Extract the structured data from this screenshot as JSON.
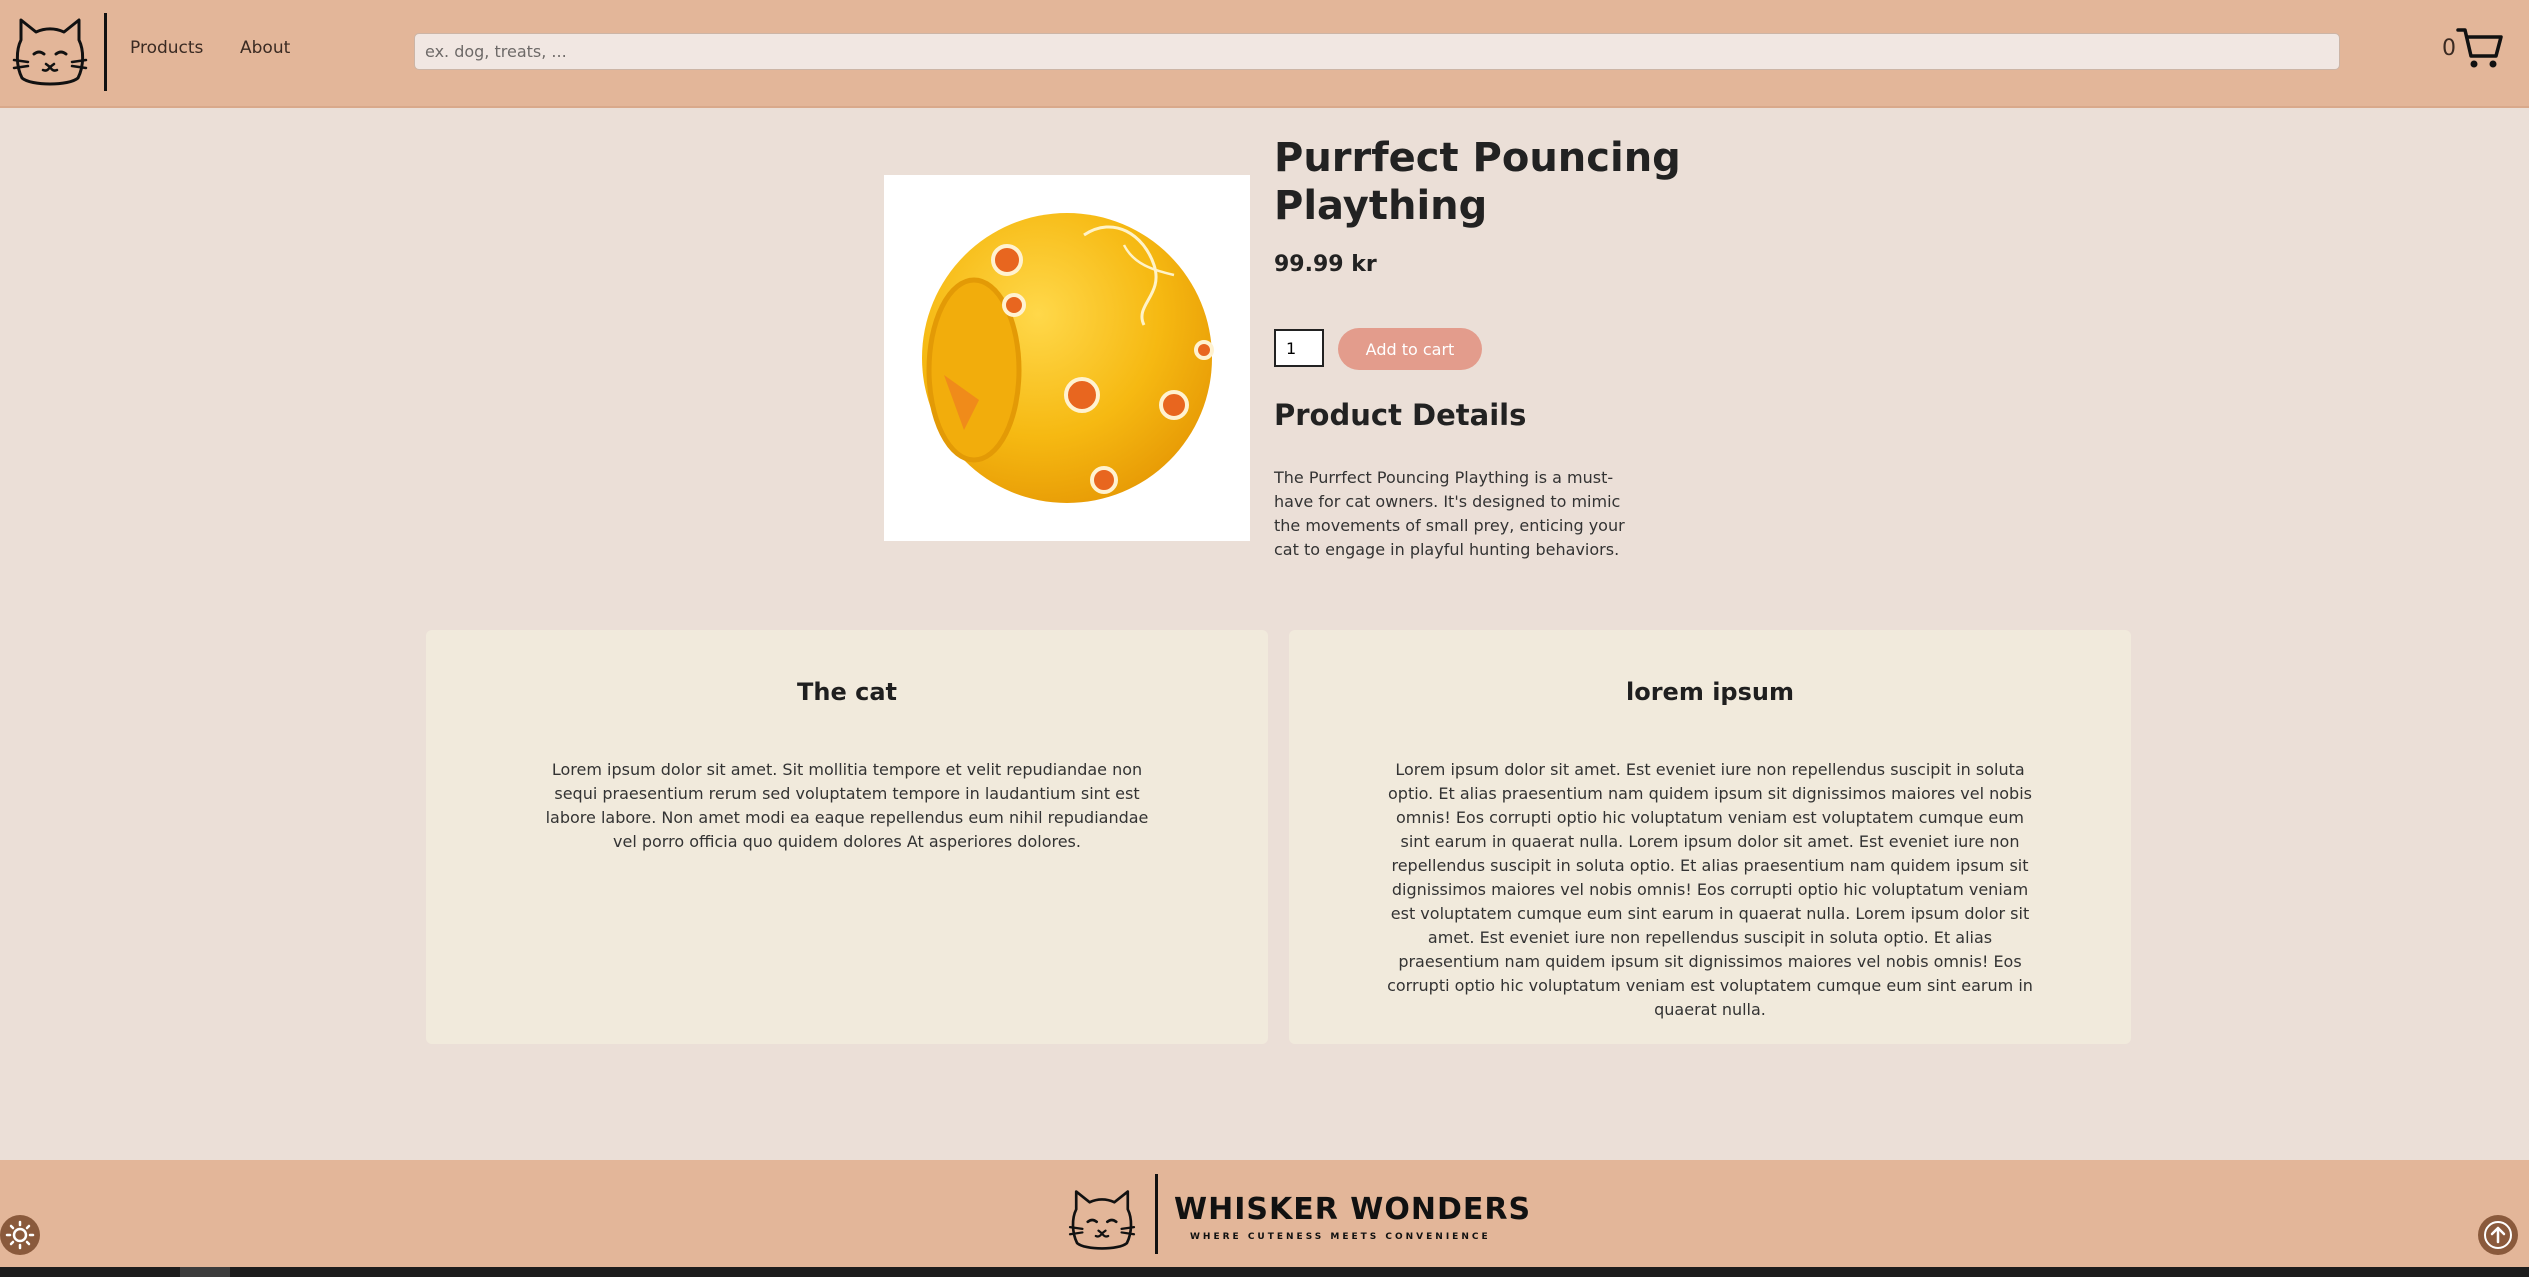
{
  "header": {
    "logo_icon": "cat-face-icon",
    "nav": [
      {
        "label": "Products"
      },
      {
        "label": "About"
      }
    ],
    "search": {
      "placeholder": "ex. dog, treats, ...",
      "value": ""
    },
    "cart": {
      "count": "0",
      "icon": "shopping-cart-icon"
    }
  },
  "product": {
    "image_icon": "yellow-treat-ball-toy",
    "title": "Purrfect Pouncing Plaything",
    "price": "99.99 kr",
    "quantity": "1",
    "add_to_cart_label": "Add to cart",
    "details_heading": "Product Details",
    "details_text": "The Purrfect Pouncing Plaything is a must-have for cat owners. It's designed to mimic the movements of small prey, enticing your cat to engage in playful hunting behaviors."
  },
  "cards": [
    {
      "title": "The cat",
      "text": "Lorem ipsum dolor sit amet. Sit mollitia tempore et velit repudiandae non sequi praesentium rerum sed voluptatem tempore in laudantium sint est labore labore. Non amet modi ea eaque repellendus eum nihil repudiandae vel porro officia quo quidem dolores At asperiores dolores."
    },
    {
      "title": "lorem ipsum",
      "text": "Lorem ipsum dolor sit amet. Est eveniet iure non repellendus suscipit in soluta optio. Et alias praesentium nam quidem ipsum sit dignissimos maiores vel nobis omnis! Eos corrupti optio hic voluptatum veniam est voluptatem cumque eum sint earum in quaerat nulla. Lorem ipsum dolor sit amet. Est eveniet iure non repellendus suscipit in soluta optio. Et alias praesentium nam quidem ipsum sit dignissimos maiores vel nobis omnis! Eos corrupti optio hic voluptatum veniam est voluptatem cumque eum sint earum in quaerat nulla. Lorem ipsum dolor sit amet. Est eveniet iure non repellendus suscipit in soluta optio. Et alias praesentium nam quidem ipsum sit dignissimos maiores vel nobis omnis! Eos corrupti optio hic voluptatum veniam est voluptatem cumque eum sint earum in quaerat nulla."
    }
  ],
  "footer": {
    "brand_name": "WHISKER WONDERS",
    "tagline": "WHERE CUTENESS MEETS CONVENIENCE",
    "logo_icon": "cat-face-icon"
  },
  "controls": {
    "theme_toggle_icon": "sun-icon",
    "scroll_top_icon": "arrow-up-icon"
  },
  "colors": {
    "header_bg": "#e3b699",
    "page_bg": "#ebdfd7",
    "card_bg": "#f1eadc",
    "accent_button": "#e39c8c",
    "control_bg": "#8a5a3c"
  }
}
